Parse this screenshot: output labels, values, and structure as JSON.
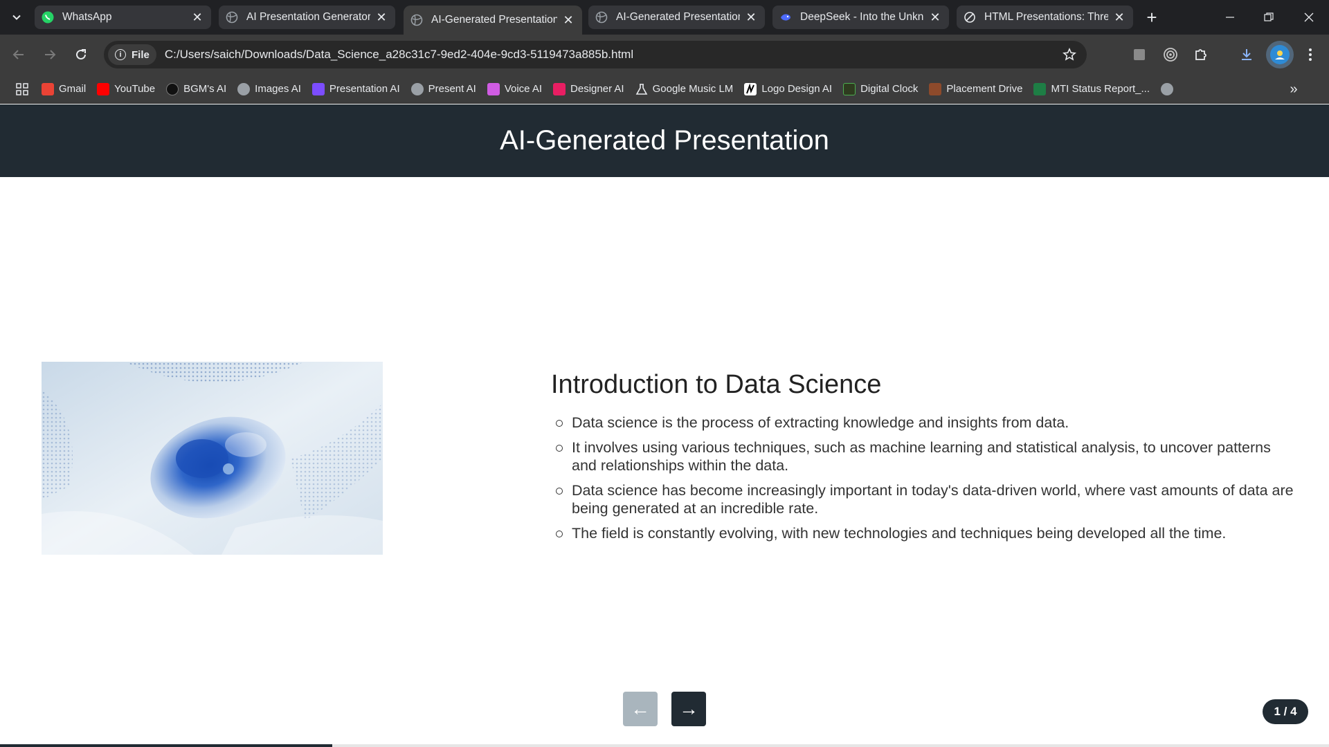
{
  "browser": {
    "tabs": [
      {
        "title": "WhatsApp",
        "icon": "whatsapp-icon",
        "active": false
      },
      {
        "title": "AI Presentation Generator",
        "icon": "globe-icon",
        "active": false
      },
      {
        "title": "AI-Generated Presentation",
        "icon": "globe-icon",
        "active": true
      },
      {
        "title": "AI-Generated Presentation",
        "icon": "globe-icon",
        "active": false
      },
      {
        "title": "DeepSeek - Into the Unkno",
        "icon": "deepseek-icon",
        "active": false
      },
      {
        "title": "HTML Presentations: Three",
        "icon": "ai-icon",
        "active": false
      }
    ],
    "address": {
      "chip_label": "File",
      "url": "C:/Users/saich/Downloads/Data_Science_a28c31c7-9ed2-404e-9cd3-5119473a885b.html"
    },
    "bookmarks": [
      {
        "label": "Gmail",
        "color": "#ea4335"
      },
      {
        "label": "YouTube",
        "color": "#ff0000"
      },
      {
        "label": "BGM's AI",
        "color": "#111111"
      },
      {
        "label": "Images AI",
        "color": "#9aa0a6"
      },
      {
        "label": "Presentation AI",
        "color": "#7c4dff"
      },
      {
        "label": "Present AI",
        "color": "#9aa0a6"
      },
      {
        "label": "Voice AI",
        "color": "#d05ce3"
      },
      {
        "label": "Designer AI",
        "color": "#e91e63"
      },
      {
        "label": "Google Music LM",
        "color": "#e8eaed"
      },
      {
        "label": "Logo Design AI",
        "color": "#ffffff"
      },
      {
        "label": "Digital Clock",
        "color": "#4caf50"
      },
      {
        "label": "Placement Drive",
        "color": "#8d4a2b"
      },
      {
        "label": "MTI Status Report_...",
        "color": "#1e7e45"
      }
    ]
  },
  "page": {
    "header_title": "AI-Generated Presentation",
    "slide": {
      "title": "Introduction to Data Science",
      "bullets": [
        "Data science is the process of extracting knowledge and insights from data.",
        "It involves using various techniques, such as machine learning and statistical analysis, to uncover patterns and relationships within the data.",
        "Data science has become increasingly important in today's data-driven world, where vast amounts of data are being generated at an incredible rate.",
        "The field is constantly evolving, with new technologies and techniques being developed all the time."
      ]
    },
    "nav": {
      "prev_label": "←",
      "next_label": "→"
    },
    "counter": "1 / 4",
    "progress": 0.25
  }
}
